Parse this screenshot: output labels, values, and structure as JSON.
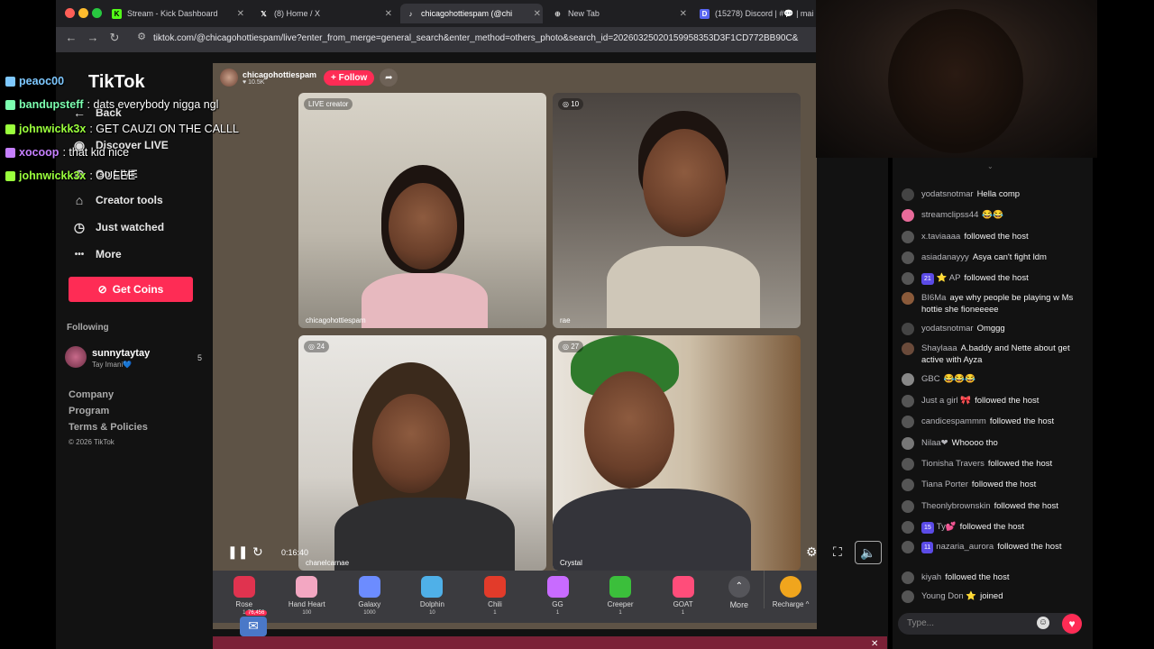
{
  "browser": {
    "tabs": [
      {
        "title": "Stream - Kick Dashboard",
        "icon": "K",
        "color": "#53fc18"
      },
      {
        "title": "(8) Home / X",
        "icon": "X",
        "color": "#ffffff"
      },
      {
        "title": "chicagohottiespam (@chi",
        "icon": "♪",
        "color": "#ffffff"
      },
      {
        "title": "New Tab",
        "icon": "⊕",
        "color": "#cccccc"
      },
      {
        "title": "(15278) Discord | #💬 | mai",
        "icon": "D",
        "color": "#5865f2"
      }
    ],
    "url": "tiktok.com/@chicagohottiespam/live?enter_from_merge=general_search&enter_method=others_photo&search_id=20260325020159958353D3F1CD772BB90C&"
  },
  "sidebar": {
    "logo": "TikTok",
    "items": [
      {
        "label": "Back",
        "icon": "←"
      },
      {
        "label": "Discover LIVE",
        "icon": "◉"
      },
      {
        "label": "Go LIVE",
        "icon": "⊕"
      },
      {
        "label": "Creator tools",
        "icon": "⌂"
      },
      {
        "label": "Just watched",
        "icon": "◷"
      },
      {
        "label": "More",
        "icon": "•••"
      }
    ],
    "get_coins": "Get Coins",
    "following_heading": "Following",
    "following": [
      {
        "name": "sunnytaytay",
        "sub": "Tay Imani💙",
        "count": "5"
      }
    ],
    "footer": [
      "Company",
      "Program",
      "Terms & Policies",
      "© 2026 TikTok"
    ]
  },
  "live": {
    "host": "chicagohottiespam",
    "followers": "♥ 10.5K",
    "follow_label": "+ Follow",
    "time": "0:16:40",
    "cells": [
      {
        "tag": "LIVE creator",
        "name": "chicagohottiespam"
      },
      {
        "tag": "◎ 10",
        "name": "rae"
      },
      {
        "tag": "◎ 24",
        "name": "chanelcarnae"
      },
      {
        "tag": "◎ 27",
        "name": "Crystal"
      }
    ]
  },
  "gifts": [
    {
      "name": "Rose",
      "price": "1",
      "color": "#e0334f"
    },
    {
      "name": "Hand Heart",
      "price": "100",
      "color": "#f3a7c2"
    },
    {
      "name": "Galaxy",
      "price": "1000",
      "color": "#6c8cff"
    },
    {
      "name": "Dolphin",
      "price": "10",
      "color": "#4fb0e8"
    },
    {
      "name": "Chili",
      "price": "1",
      "color": "#e23b2a"
    },
    {
      "name": "GG",
      "price": "1",
      "color": "#c86bff"
    },
    {
      "name": "Creeper",
      "price": "1",
      "color": "#3bbf3b"
    },
    {
      "name": "GOAT",
      "price": "1",
      "color": "#ff4d7a"
    }
  ],
  "gift_more": "More",
  "recharge": "Recharge ^",
  "mail_count": "76,456",
  "chat": {
    "messages": [
      {
        "user": "yodatsnotmar",
        "text": "Hella comp",
        "color": "#444"
      },
      {
        "user": "streamclipss44",
        "text": "😂😂",
        "color": "#e86b9a"
      },
      {
        "user": "x.taviaaaa",
        "text": "followed the host",
        "color": "#555"
      },
      {
        "user": "asiadanayyy",
        "text": "Asya can't fight ldm",
        "color": "#555"
      },
      {
        "user": "⭐ AP",
        "badge": "21",
        "text": "followed the host",
        "color": "#555"
      },
      {
        "user": "BI6Ma",
        "text": "aye why people be playing w Ms hottie she fioneeeee",
        "color": "#8a5a3a"
      },
      {
        "user": "yodatsnotmar",
        "text": "Omggg",
        "color": "#444"
      },
      {
        "user": "Shaylaaa",
        "text": "A.baddy and Nette about get active with Ayza",
        "color": "#6a4a3a"
      },
      {
        "user": "GBC",
        "text": "😂😂😂",
        "color": "#888"
      },
      {
        "user": "Just a girl 🎀",
        "text": "followed the host",
        "color": "#555"
      },
      {
        "user": "candicespammm",
        "text": "followed the host",
        "color": "#555"
      },
      {
        "user": "Nilaa❤",
        "text": "Whoooo tho",
        "color": "#777"
      },
      {
        "user": "Tionisha Travers",
        "text": "followed the host",
        "color": "#555"
      },
      {
        "user": "Tiana Porter",
        "text": "followed the host",
        "color": "#555"
      },
      {
        "user": "Theonlybrownskin",
        "text": "followed the host",
        "color": "#555"
      },
      {
        "user": "Ty💕",
        "badge": "15",
        "text": "followed the host",
        "color": "#555"
      },
      {
        "user": "nazaria_aurora",
        "badge": "11",
        "text": "followed the host",
        "color": "#555"
      },
      {
        "user": "kiyah",
        "text": "followed the host",
        "color": "#555"
      },
      {
        "user": "Young Don ⭐",
        "text": "joined",
        "color": "#555"
      }
    ],
    "input_placeholder": "Type..."
  },
  "kick_chat": [
    {
      "user": "peaoc00",
      "text": "",
      "color": "#7ec8ff"
    },
    {
      "user": "bandupsteff",
      "text": ": dats everybody nigga ngl",
      "color": "#7cffb0"
    },
    {
      "user": "johnwickk3x",
      "text": ": GET CAUZI ON THE CALLL",
      "color": "#9aff3c"
    },
    {
      "user": "xocoop",
      "text": ": that kid nice",
      "color": "#c680ff"
    },
    {
      "user": "johnwickk3x",
      "text": ": OUEEE",
      "color": "#9aff3c"
    }
  ]
}
